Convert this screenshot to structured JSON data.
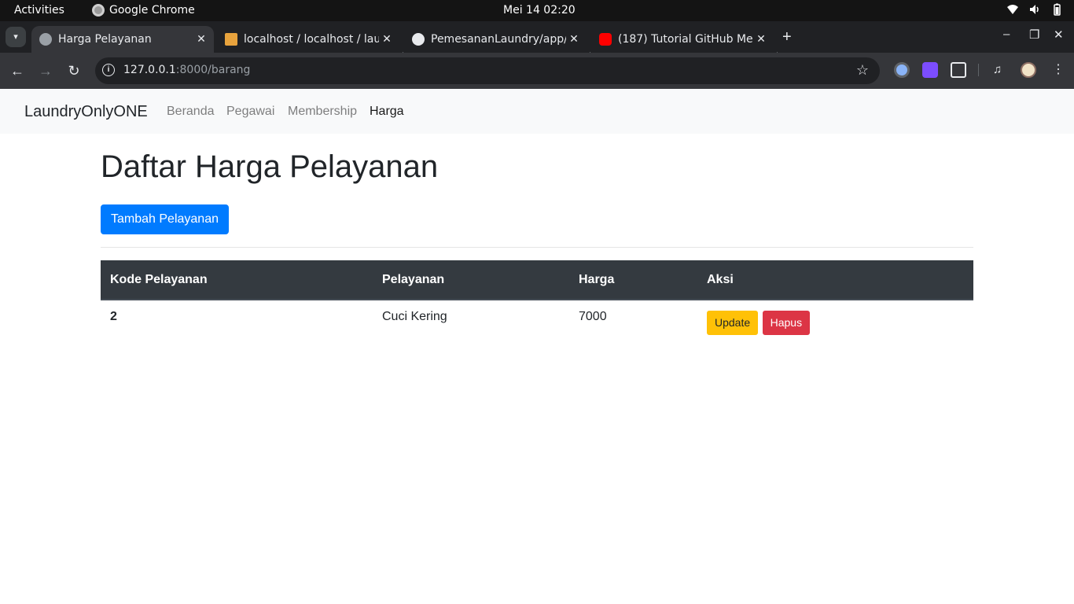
{
  "system": {
    "activities": "Activities",
    "app_name": "Google Chrome",
    "clock": "Mei 14  02:20"
  },
  "browser": {
    "tabs": [
      {
        "title": "Harga Pelayanan",
        "active": true,
        "icon": "globe-icon"
      },
      {
        "title": "localhost / localhost / lau",
        "active": false,
        "icon": "phpmyadmin-icon"
      },
      {
        "title": "PemesananLaundry/app/",
        "active": false,
        "icon": "github-icon"
      },
      {
        "title": "(187) Tutorial GitHub Me",
        "active": false,
        "icon": "youtube-icon"
      }
    ],
    "url_host": "127.0.0.1",
    "url_path": ":8000/barang"
  },
  "navbar": {
    "brand": "LaundryOnlyONE",
    "links": [
      {
        "label": "Beranda",
        "active": false
      },
      {
        "label": "Pegawai",
        "active": false
      },
      {
        "label": "Membership",
        "active": false
      },
      {
        "label": "Harga",
        "active": true
      }
    ]
  },
  "main": {
    "title": "Daftar Harga Pelayanan",
    "add_button": "Tambah Pelayanan",
    "table": {
      "headers": [
        "Kode Pelayanan",
        "Pelayanan",
        "Harga",
        "Aksi"
      ],
      "rows": [
        {
          "kode": "2",
          "pelayanan": "Cuci Kering",
          "harga": "7000",
          "update_label": "Update",
          "delete_label": "Hapus"
        }
      ]
    }
  },
  "colors": {
    "primary": "#007bff",
    "warning": "#ffc107",
    "danger": "#dc3545",
    "table_header": "#343a40",
    "navbar_bg": "#f8f9fa"
  }
}
